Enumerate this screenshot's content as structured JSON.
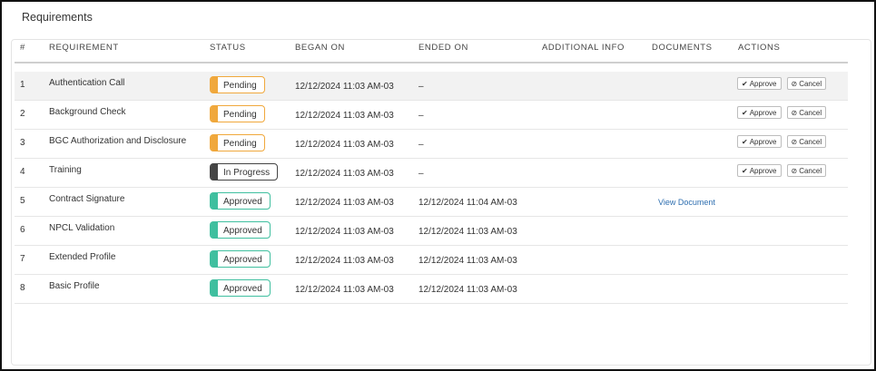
{
  "title": "Requirements",
  "columns": {
    "num": "#",
    "requirement": "REQUIREMENT",
    "status": "STATUS",
    "began": "BEGAN ON",
    "ended": "ENDED ON",
    "additional": "ADDITIONAL INFO",
    "documents": "DOCUMENTS",
    "actions": "ACTIONS"
  },
  "actions": {
    "approve": "Approve",
    "cancel": "Cancel"
  },
  "colors": {
    "pending": "#f0a83c",
    "in_progress": "#444444",
    "approved": "#3fbf9f",
    "link": "#2f6fb0"
  },
  "rows": [
    {
      "num": "1",
      "requirement": "Authentication Call",
      "status": "Pending",
      "began": "12/12/2024 11:03 AM-03",
      "ended": "–",
      "document": ""
    },
    {
      "num": "2",
      "requirement": "Background Check",
      "status": "Pending",
      "began": "12/12/2024 11:03 AM-03",
      "ended": "–",
      "document": ""
    },
    {
      "num": "3",
      "requirement": "BGC Authorization and Disclosure",
      "status": "Pending",
      "began": "12/12/2024 11:03 AM-03",
      "ended": "–",
      "document": ""
    },
    {
      "num": "4",
      "requirement": "Training",
      "status": "In Progress",
      "began": "12/12/2024 11:03 AM-03",
      "ended": "–",
      "document": ""
    },
    {
      "num": "5",
      "requirement": "Contract Signature",
      "status": "Approved",
      "began": "12/12/2024 11:03 AM-03",
      "ended": "12/12/2024 11:04 AM-03",
      "document": "View Document"
    },
    {
      "num": "6",
      "requirement": "NPCL Validation",
      "status": "Approved",
      "began": "12/12/2024 11:03 AM-03",
      "ended": "12/12/2024 11:03 AM-03",
      "document": ""
    },
    {
      "num": "7",
      "requirement": "Extended Profile",
      "status": "Approved",
      "began": "12/12/2024 11:03 AM-03",
      "ended": "12/12/2024 11:03 AM-03",
      "document": ""
    },
    {
      "num": "8",
      "requirement": "Basic Profile",
      "status": "Approved",
      "began": "12/12/2024 11:03 AM-03",
      "ended": "12/12/2024 11:03 AM-03",
      "document": ""
    }
  ]
}
